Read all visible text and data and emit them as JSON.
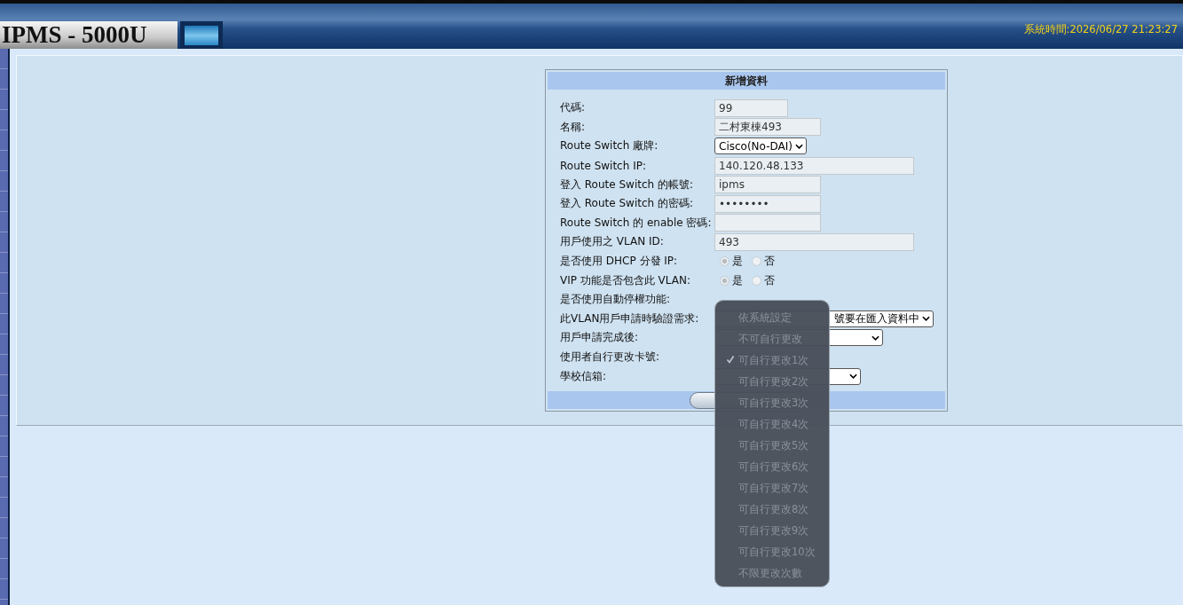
{
  "header": {
    "title": "IPMS - 5000U",
    "system_time": "系統時間:2026/06/27 21:23:27"
  },
  "form": {
    "title": "新增資料",
    "fields": [
      {
        "kind": "input",
        "label": "代碼:",
        "value": "99"
      },
      {
        "kind": "input",
        "label": "名稱:",
        "value": "二村東棟493"
      },
      {
        "kind": "select",
        "label": "Route Switch 廠牌:",
        "value": "Cisco(No-DAI)"
      },
      {
        "kind": "input",
        "label": "Route Switch IP:",
        "value": "140.120.48.133"
      },
      {
        "kind": "input",
        "label": "登入 Route Switch 的帳號:",
        "value": "ipms"
      },
      {
        "kind": "password",
        "label": "登入 Route Switch 的密碼:",
        "value": "••••••••"
      },
      {
        "kind": "password",
        "label": "Route Switch 的 enable 密碼:"
      },
      {
        "kind": "input",
        "label": "用戶使用之 VLAN ID:",
        "value": "493"
      },
      {
        "kind": "radio",
        "label": "是否使用 DHCP 分發 IP:",
        "options": [
          {
            "label": "是",
            "selected": true
          },
          {
            "label": "否",
            "selected": false
          }
        ]
      },
      {
        "kind": "radio",
        "label": "VIP 功能是否包含此 VLAN:",
        "options": [
          {
            "label": "是",
            "selected": true
          },
          {
            "label": "否",
            "selected": false
          }
        ]
      },
      {
        "kind": "radio",
        "label": "是否使用自動停權功能:"
      },
      {
        "kind": "select",
        "label": "此VLAN用戶申請時驗證需求:",
        "value": "號要在匯入資料中"
      },
      {
        "kind": "select",
        "label": "用戶申請完成後:"
      },
      {
        "kind": "dropdown",
        "label": "使用者自行更改卡號:",
        "options": [
          {
            "label": "依系統設定",
            "selected": false
          },
          {
            "label": "不可自行更改",
            "selected": false
          },
          {
            "label": "可自行更改1次",
            "selected": true
          },
          {
            "label": "可自行更改2次",
            "selected": false
          },
          {
            "label": "可自行更改3次",
            "selected": false
          },
          {
            "label": "可自行更改4次",
            "selected": false
          },
          {
            "label": "可自行更改5次",
            "selected": false
          },
          {
            "label": "可自行更改6次",
            "selected": false
          },
          {
            "label": "可自行更改7次",
            "selected": false
          },
          {
            "label": "可自行更改8次",
            "selected": false
          },
          {
            "label": "可自行更改9次",
            "selected": false
          },
          {
            "label": "可自行更改10次",
            "selected": false
          },
          {
            "label": "不限更改次數",
            "selected": false
          }
        ]
      },
      {
        "kind": "select",
        "label": "學校信箱:"
      }
    ]
  }
}
